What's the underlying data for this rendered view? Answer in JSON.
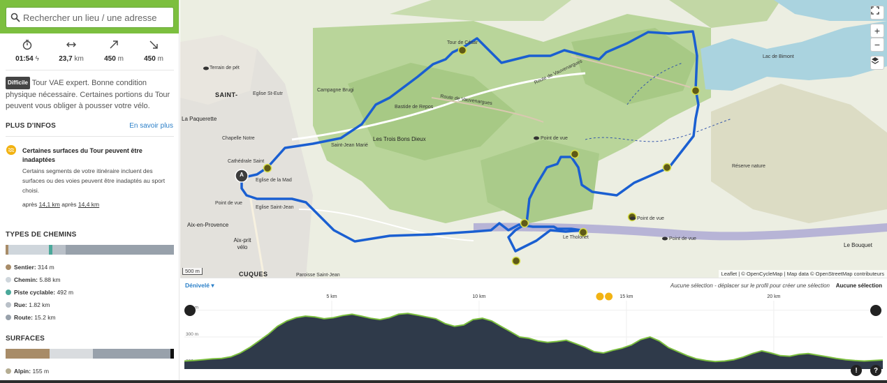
{
  "search": {
    "placeholder": "Rechercher un lieu / une adresse"
  },
  "stats": {
    "duration": "01:54",
    "distance_value": "23,7",
    "distance_unit": "km",
    "ascent_value": "450",
    "ascent_unit": "m",
    "descent_value": "450",
    "descent_unit": "m"
  },
  "difficulty": {
    "badge": "Difficile",
    "text": "Tour VAE expert. Bonne condition physique nécessaire. Certaines portions du Tour peuvent vous obliger à pousser votre vélo."
  },
  "more_info": {
    "title": "PLUS D'INFOS",
    "link": "En savoir plus"
  },
  "warning": {
    "title": "Certaines surfaces du Tour peuvent être inadaptées",
    "text": "Certains segments de votre itinéraire incluent des surfaces ou des voies peuvent être inadaptés au sport choisi.",
    "after1_prefix": "après",
    "after1_value": "14,1 km",
    "after2_prefix": "après",
    "after2_value": "14,4 km"
  },
  "path_types": {
    "title": "TYPES DE CHEMINS",
    "items": [
      {
        "label": "Sentier:",
        "value": "314 m",
        "color": "#a88c68"
      },
      {
        "label": "Chemin:",
        "value": "5.88 km",
        "color": "#cfd6dc"
      },
      {
        "label": "Piste cyclable:",
        "value": "492 m",
        "color": "#4aa89a"
      },
      {
        "label": "Rue:",
        "value": "1.82 km",
        "color": "#b9c0c8"
      },
      {
        "label": "Route:",
        "value": "15.2 km",
        "color": "#98a1ab"
      }
    ]
  },
  "surfaces": {
    "title": "SURFACES",
    "items": [
      {
        "label": "Alpin:",
        "value": "155 m",
        "color": "#b5ad92"
      }
    ]
  },
  "map": {
    "labels": {
      "saint": "SAINT-",
      "paquerette": "La Paquerette",
      "aix": "Aix-en-Provence",
      "aixprit": "Aix-prit vélo",
      "cuques": "CUQUES",
      "trois_bons_dieux": "Les Trois Bons Dieux",
      "route_vauvenargues": "Route de Vauvenargues",
      "route_vauvenargues2": "Route de Vauvenargues",
      "lac": "Lac de Bimont",
      "tour_cesar": "Tour de César",
      "bastide": "Bastide de Repos",
      "campagne": "Campagne Brugi",
      "saint_jean": "Saint-Jean Marié",
      "reserve": "Réserve nature",
      "point_vue1": "Point de vue",
      "point_vue2": "Point de vue",
      "point_vue3": "Point de vue",
      "point_vue4": "Point de vue",
      "tholonet": "Le Tholonet",
      "bouquet": "Le Bouquet",
      "terrain": "Terrain de pét",
      "eglise": "Eglise de la Mad",
      "eglise2": "Eglise St-Eutr",
      "cathedrale": "Cathédrale Saint",
      "chapelle": "Chapelle Notre",
      "saint_jean2": "Eglise Saint-Jean",
      "point_vue_aix": "Point de vue",
      "paroisse": "Paroisse Saint-Jean"
    },
    "scale": "500 m",
    "attribution": "Leaflet | © OpenCycleMap | Map data © OpenStreetMap contributeurs",
    "start_marker": "A",
    "waypoints": [
      "1",
      "2",
      "3",
      "4",
      "5",
      "6",
      "7",
      "8",
      "9"
    ]
  },
  "profile": {
    "mode": "Dénivelé",
    "hint": "Aucune sélection - déplacer sur le profil pour créer une sélection",
    "selection": "Aucune sélection",
    "km_ticks": [
      "5 km",
      "10 km",
      "15 km",
      "20 km"
    ],
    "y_ticks": [
      "400 m",
      "300 m",
      "200 m"
    ],
    "elevations_m": [
      210,
      212,
      215,
      218,
      220,
      226,
      240,
      260,
      285,
      310,
      340,
      360,
      372,
      378,
      375,
      368,
      372,
      380,
      385,
      378,
      370,
      365,
      372,
      385,
      388,
      382,
      375,
      368,
      350,
      340,
      345,
      365,
      370,
      360,
      340,
      320,
      300,
      295,
      285,
      280,
      283,
      288,
      275,
      262,
      245,
      240,
      250,
      258,
      270,
      290,
      300,
      285,
      260,
      245,
      230,
      218,
      212,
      208,
      210,
      215,
      225,
      238,
      248,
      240,
      230,
      228,
      235,
      238,
      232,
      226,
      220,
      215,
      212,
      210,
      212,
      214
    ]
  }
}
